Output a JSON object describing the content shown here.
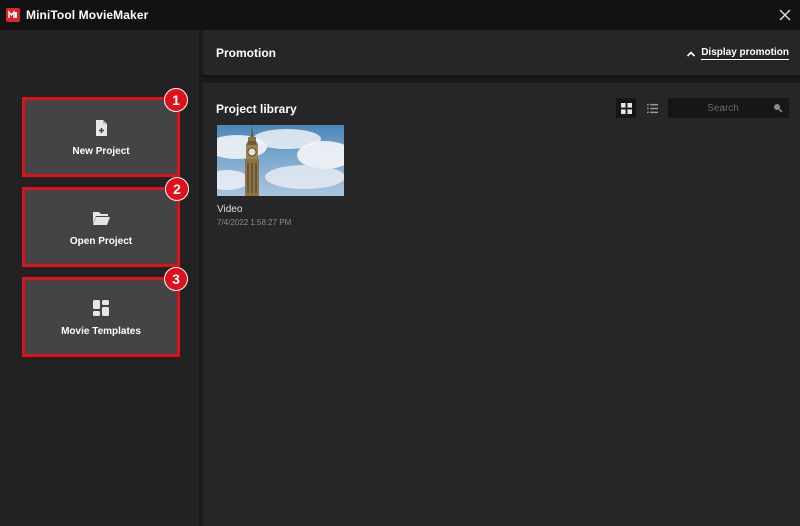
{
  "titlebar": {
    "title": "MiniTool MovieMaker"
  },
  "sidebar": {
    "actions": [
      {
        "label": "New Project",
        "badge": "1",
        "icon": "new-file-icon"
      },
      {
        "label": "Open Project",
        "badge": "2",
        "icon": "folder-open-icon"
      },
      {
        "label": "Movie Templates",
        "badge": "3",
        "icon": "templates-icon"
      }
    ]
  },
  "promotion": {
    "title": "Promotion",
    "toggle_label": "Display promotion",
    "toggle_icon": "chevron-up-icon"
  },
  "library": {
    "title": "Project library",
    "view_modes": [
      "grid-view-icon",
      "list-view-icon"
    ],
    "active_view": "grid",
    "search": {
      "placeholder": "Search",
      "value": ""
    },
    "items": [
      {
        "name": "Video",
        "date": "7/4/2022 1:58:27 PM",
        "thumbnail": "big-ben-clock-tower-sky"
      }
    ]
  },
  "colors": {
    "accent_red": "#e0101a",
    "titlebar_bg": "#121212",
    "panel_bg": "#262626",
    "card_bg": "#444444"
  }
}
